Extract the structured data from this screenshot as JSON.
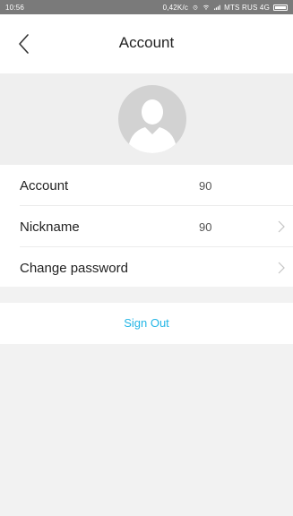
{
  "status_bar": {
    "time": "10:56",
    "speed": "0,42K/c",
    "carrier": "MTS RUS 4G",
    "icons": [
      "alarm-icon",
      "wifi-icon",
      "signal-icon",
      "battery-icon"
    ]
  },
  "header": {
    "title": "Account",
    "back_icon": "chevron-left-icon"
  },
  "profile": {
    "avatar_icon": "default-avatar-icon"
  },
  "rows": [
    {
      "label": "Account",
      "value": "90",
      "chevron": false
    },
    {
      "label": "Nickname",
      "value": "90",
      "chevron": true
    },
    {
      "label": "Change password",
      "value": "",
      "chevron": true
    }
  ],
  "sign_out": {
    "label": "Sign Out"
  },
  "colors": {
    "accent": "#24b6e6",
    "background": "#f2f2f2",
    "status_bar": "#7a7a7a"
  }
}
